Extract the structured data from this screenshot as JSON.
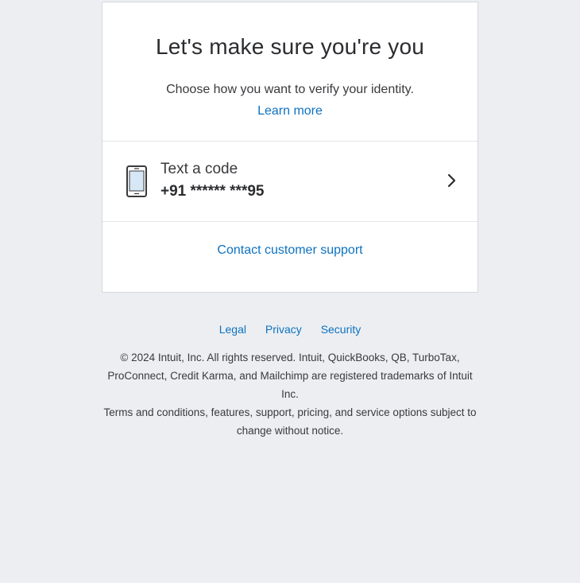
{
  "card": {
    "title": "Let's make sure you're you",
    "subtitle": "Choose how you want to verify your identity.",
    "learn_more": "Learn more",
    "option": {
      "label": "Text a code",
      "phone": "+91 ****** ***95",
      "icon": "mobile-phone-icon"
    },
    "support_link": "Contact customer support"
  },
  "footer": {
    "links": [
      "Legal",
      "Privacy",
      "Security"
    ],
    "copyright": "© 2024 Intuit, Inc. All rights reserved. Intuit, QuickBooks, QB, TurboTax, ProConnect, Credit Karma, and Mailchimp are registered trademarks of Intuit Inc.",
    "terms": "Terms and conditions, features, support, pricing, and service options subject to change without notice."
  },
  "colors": {
    "background": "#eceef1",
    "link": "#0d72c1",
    "text": "#393a3d"
  }
}
